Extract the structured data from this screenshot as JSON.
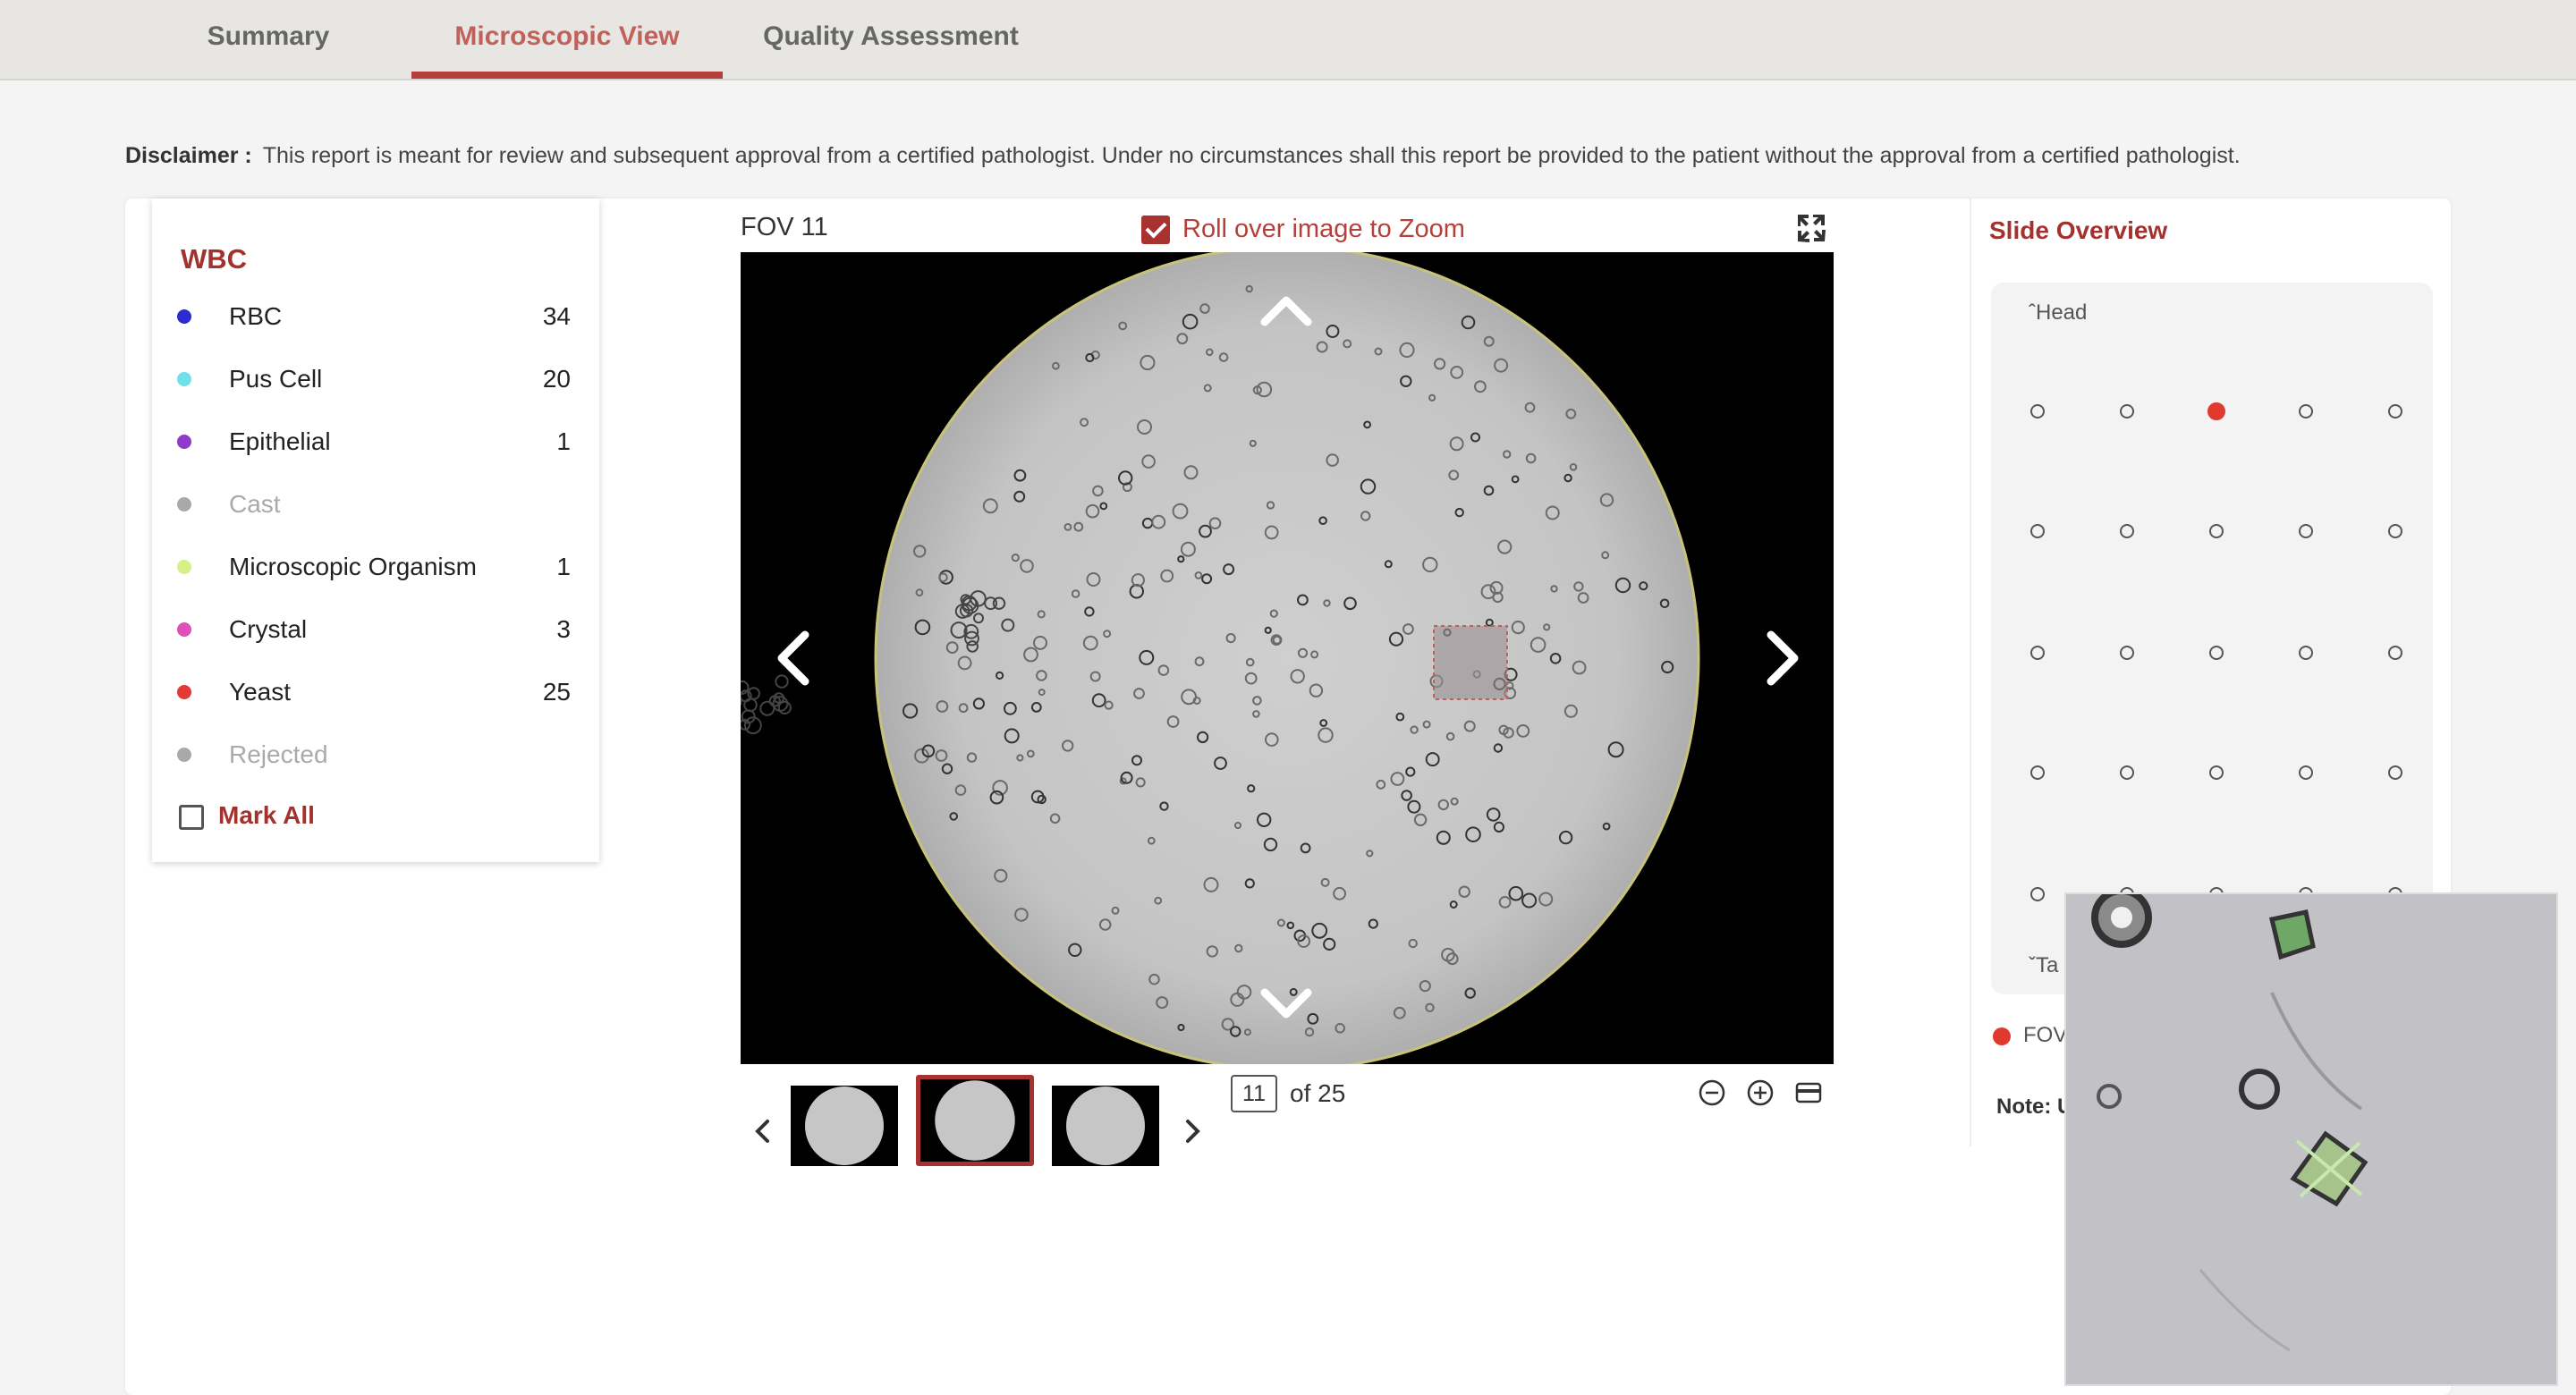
{
  "tabs": [
    {
      "label": "Summary",
      "active": false
    },
    {
      "label": "Microscopic View",
      "active": true
    },
    {
      "label": "Quality Assessment",
      "active": false
    }
  ],
  "disclaimer": {
    "label": "Disclaimer :",
    "text": "This report is meant for review and subsequent approval from a certified pathologist. Under no circumstances shall this report be provided to the patient without the approval from a certified pathologist."
  },
  "legend": {
    "title": "WBC",
    "items": [
      {
        "label": "RBC",
        "count": "34",
        "color": "#2a2ccf"
      },
      {
        "label": "Pus Cell",
        "count": "20",
        "color": "#6fe0ea"
      },
      {
        "label": "Epithelial",
        "count": "1",
        "color": "#8e3bc9"
      },
      {
        "label": "Cast",
        "count": "",
        "color": "#a9a9a9"
      },
      {
        "label": "Microscopic Organism",
        "count": "1",
        "color": "#d7f08a"
      },
      {
        "label": "Crystal",
        "count": "3",
        "color": "#e04fb7"
      },
      {
        "label": "Yeast",
        "count": "25",
        "color": "#e53935"
      },
      {
        "label": "Rejected",
        "count": "",
        "color": "#a9a9a9"
      }
    ],
    "mark_all_label": "Mark All"
  },
  "viewer": {
    "fov_label": "FOV 11",
    "zoom_label": "Roll over image to Zoom",
    "zoom_checked": true,
    "current_page": "11",
    "of_label": "of 25",
    "thumbnail_count": 3,
    "active_thumbnail": 2
  },
  "slide_overview": {
    "title": "Slide Overview",
    "head_label": "Head",
    "tail_label": "Ta",
    "active_dot": {
      "row": 1,
      "col": 3
    },
    "rows": 5,
    "cols": 5,
    "fov_label": "FOV,",
    "note_label": "Note: U"
  },
  "icons": {
    "expand": "expand-icon",
    "prev": "chevron-left-icon",
    "next": "chevron-right-icon",
    "up": "chevron-up-icon",
    "down": "chevron-down-icon",
    "zoom_out": "zoom-out-icon",
    "zoom_in": "zoom-in-icon",
    "layout": "layout-icon"
  },
  "colors": {
    "accent": "#a8322f",
    "tab_active": "#c0625a",
    "active_dot": "#e03a2f"
  }
}
